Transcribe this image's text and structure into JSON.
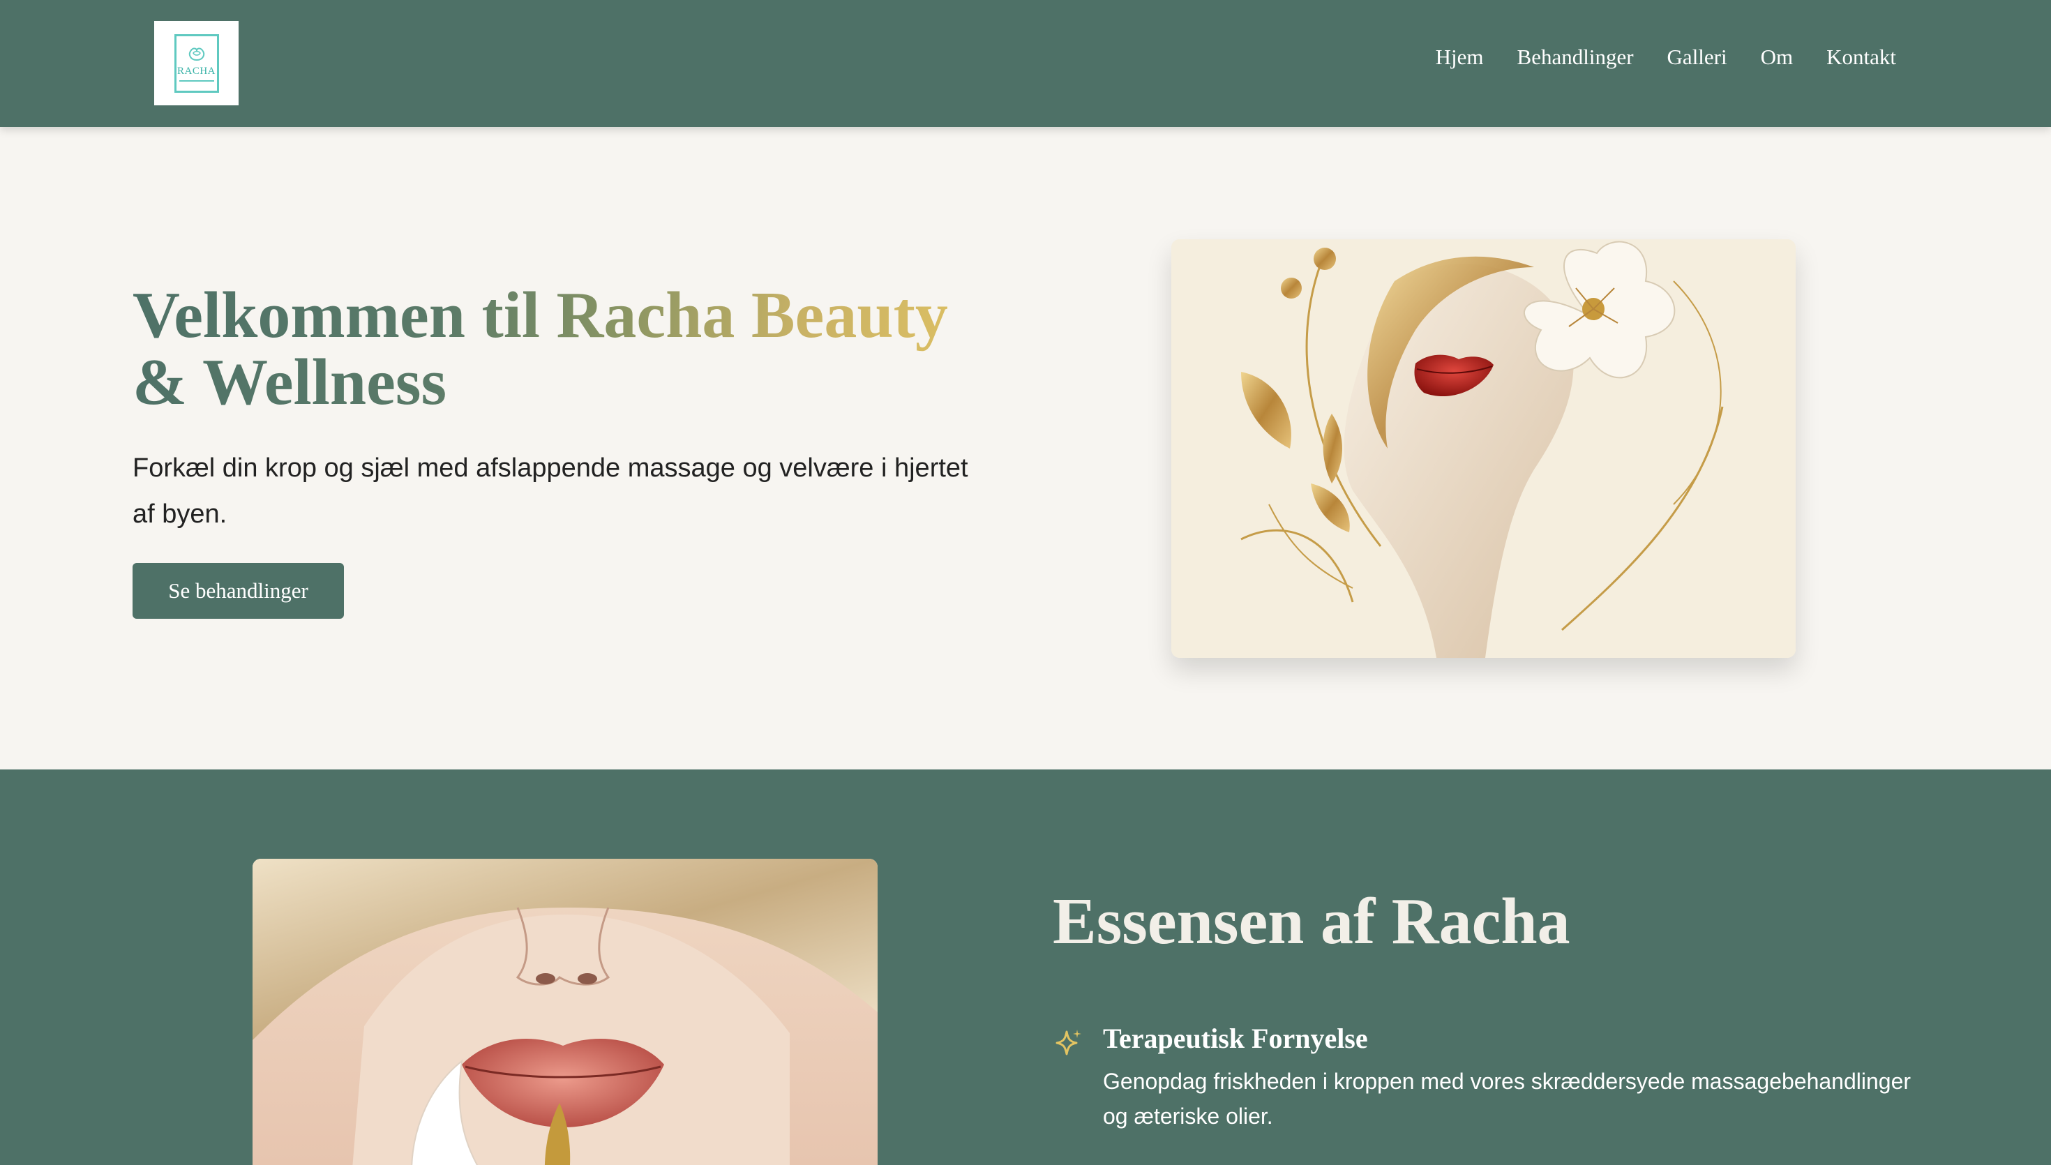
{
  "header": {
    "logo_text": "RACHA",
    "nav": [
      "Hjem",
      "Behandlinger",
      "Galleri",
      "Om",
      "Kontakt"
    ]
  },
  "hero": {
    "title_line1": "Velkommen til Racha Beauty",
    "title_line2": "& Wellness",
    "subtitle": "Forkæl din krop og sjæl med afslappende massage og velvære i hjertet af byen.",
    "cta_label": "Se behandlinger"
  },
  "essence": {
    "title": "Essensen af Racha",
    "feature": {
      "icon": "sparkle-icon",
      "title": "Terapeutisk Fornyelse",
      "text": "Genopdag friskheden i kroppen med vores skræddersyede massagebehandlinger og æteriske olier."
    }
  },
  "colors": {
    "brand_green": "#4e7167",
    "cream": "#f7f5f1",
    "gold": "#d9bb60",
    "logo_teal": "#5fc9c0"
  }
}
